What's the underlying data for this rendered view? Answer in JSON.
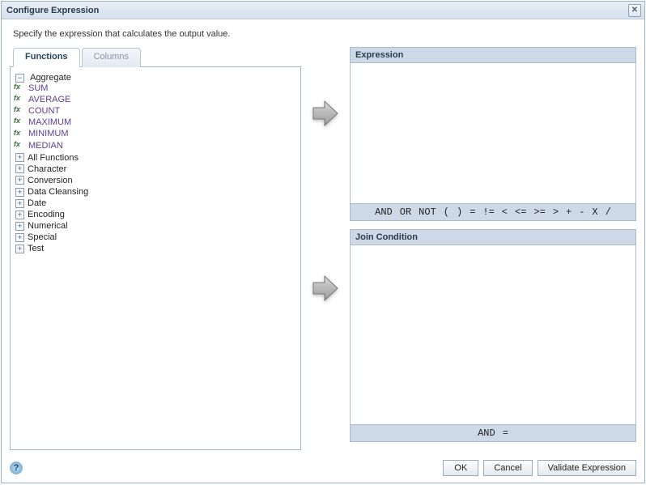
{
  "title": "Configure Expression",
  "instruction": "Specify the expression that calculates the output value.",
  "tabs": {
    "functions": "Functions",
    "columns": "Columns"
  },
  "tree": {
    "aggregate": {
      "label": "Aggregate",
      "items": [
        "SUM",
        "AVERAGE",
        "COUNT",
        "MAXIMUM",
        "MINIMUM",
        "MEDIAN"
      ]
    },
    "categories": [
      "All Functions",
      "Character",
      "Conversion",
      "Data Cleansing",
      "Date",
      "Encoding",
      "Numerical",
      "Special",
      "Test"
    ]
  },
  "expression": {
    "header": "Expression",
    "ops": [
      "AND",
      "OR",
      "NOT",
      "(",
      ")",
      "=",
      "!=",
      "<",
      "<=",
      ">=",
      ">",
      "+",
      "-",
      "X",
      "/"
    ]
  },
  "join": {
    "header": "Join Condition",
    "ops": [
      "AND",
      "="
    ]
  },
  "buttons": {
    "ok": "OK",
    "cancel": "Cancel",
    "validate": "Validate Expression"
  }
}
